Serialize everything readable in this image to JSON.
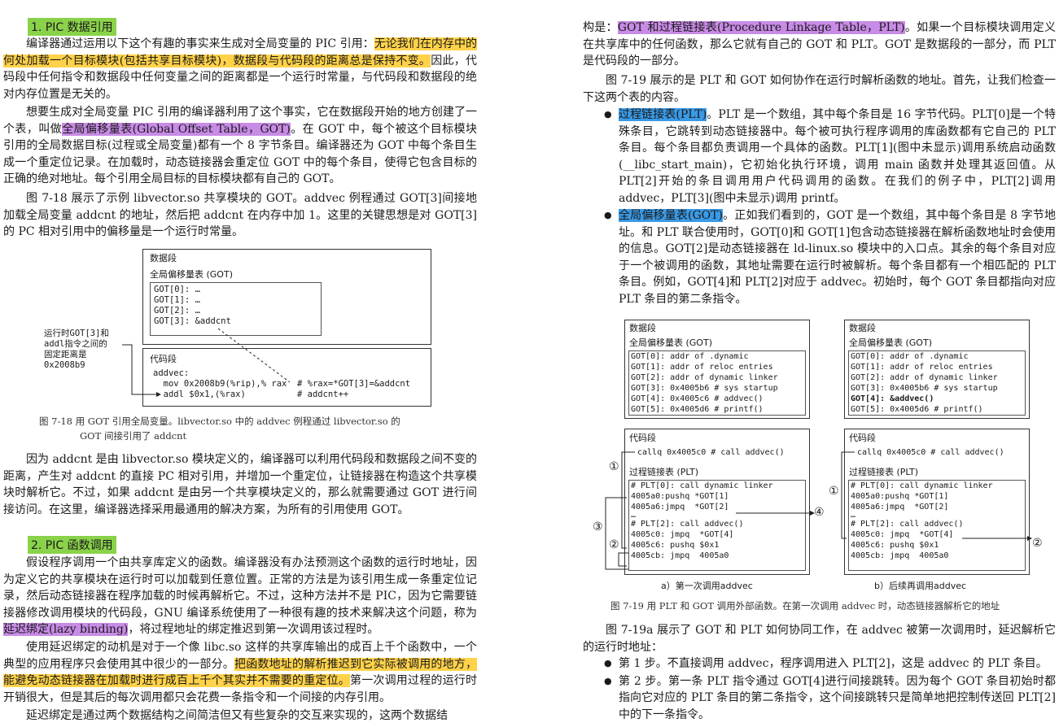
{
  "left": {
    "heading1": "1. PIC 数据引用",
    "p1_a": "编译器通过运用以下这个有趣的事实来生成对全局变量的 PIC 引用：",
    "p1_hl": "无论我们在内存中的何处加载一个目标模块(包括共享目标模块)，数据段与代码段的距离总是保持不变。",
    "p1_b": "因此，代码段中任何指令和数据段中任何变量之间的距离都是一个运行时常量，与代码段和数据段的绝对内存位置是无关的。",
    "p2_a": "想要生成对全局变量 PIC 引用的编译器利用了这个事实，它在数据段开始的地方创建了一个表，叫做",
    "p2_hl": "全局偏移量表(Global Offset Table，GOT)",
    "p2_b": "。在 GOT 中，每个被这个目标模块引用的全局数据目标(过程或全局变量)都有一个 8 字节条目。编译器还为 GOT 中每个条目生成一个重定位记录。在加载时，动态链接器会重定位 GOT 中的每个条目，使得它包含目标的正确的绝对地址。每个引用全局目标的目标模块都有自己的 GOT。",
    "p3": "图 7-18 展示了示例 libvector.so 共享模块的 GOT。addvec 例程通过 GOT[3]间接地加载全局变量 addcnt 的地址，然后把 addcnt 在内存中加 1。这里的关键思想是对 GOT[3]的 PC 相对引用中的偏移量是一个运行时常量。",
    "fig718": {
      "data_seg": "数据段",
      "got_title": "全局偏移量表 (GOT)",
      "got_rows": [
        "GOT[0]: …",
        "GOT[1]: …",
        "GOT[2]: …",
        "GOT[3]: &addcnt"
      ],
      "code_seg": "代码段",
      "code_lines": [
        "addvec:",
        "  mov 0x2008b9(%rip),% rax  # %rax=*GOT[3]=&addcnt",
        "  addl $0x1,(%rax)          # addcnt++"
      ],
      "side_note": "运行时GOT[3]和\naddl指令之间的\n固定距离是\n0x2008b9",
      "caption_1": "图 7-18  用 GOT 引用全局变量。libvector.so 中的 addvec 例程通过 libvector.so 的",
      "caption_2": "GOT 间接引用了 addcnt"
    },
    "p4": "因为 addcnt 是由 libvector.so 模块定义的，编译器可以利用代码段和数据段之间不变的距离，产生对 addcnt 的直接 PC 相对引用，并增加一个重定位，让链接器在构造这个共享模块时解析它。不过，如果 addcnt 是由另一个共享模块定义的，那么就需要通过 GOT 进行间接访问。在这里，编译器选择采用最通用的解决方案，为所有的引用使用 GOT。",
    "heading2": "2. PIC 函数调用",
    "p5_a": "假设程序调用一个由共享库定义的函数。编译器没有办法预测这个函数的运行时地址，因为定义它的共享模块在运行时可以加载到任意位置。正常的方法是为该引用生成一条重定位记录，然后动态链接器在程序加载的时候再解析它。不过，这种方法并不是 PIC，因为它需要链接器修改调用模块的代码段，GNU 编译系统使用了一种很有趣的技术来解决这个问题，称为",
    "p5_hl": "延迟绑定(lazy binding)",
    "p5_b": "，将过程地址的绑定推迟到第一次调用该过程时。",
    "p6_a": "使用延迟绑定的动机是对于一个像 libc.so 这样的共享库输出的成百上千个函数中，一个典型的应用程序只会使用其中很少的一部分。",
    "p6_hl": "把函数地址的解析推迟到它实际被调用的地方，能避免动态链接器在加载时进行成百上千个其实并不需要的重定位。",
    "p6_b": "第一次调用过程的运行时开销很大，但是其后的每次调用都只会花费一条指令和一个间接的内存引用。",
    "p7": "延迟绑定是通过两个数据结构之间简洁但又有些复杂的交互来实现的，这两个数据结"
  },
  "right": {
    "r1_a": "构是：",
    "r1_hl": "GOT 和过程链接表(Procedure Linkage Table，PLT)",
    "r1_b": "。如果一个目标模块调用定义在共享库中的任何函数，那么它就有自己的 GOT 和 PLT。GOT 是数据段的一部分，而 PLT 是代码段的一部分。",
    "r2": "图 7-19 展示的是 PLT 和 GOT 如何协作在运行时解析函数的地址。首先，让我们检查一下这两个表的内容。",
    "b1_hl": "过程链接表(PLT)",
    "b1": "。PLT 是一个数组，其中每个条目是 16 字节代码。PLT[0]是一个特殊条目，它跳转到动态链接器中。每个被可执行程序调用的库函数都有它自己的 PLT 条目。每个条目都负责调用一个具体的函数。PLT[1](图中未显示)调用系统启动函数(__libc_start_main)，它初始化执行环境，调用 main 函数并处理其返回值。从 PLT[2]开始的条目调用用户代码调用的函数。在我们的例子中，PLT[2]调用 addvec，PLT[3](图中未显示)调用 printf。",
    "b2_hl": "全局偏移量表(GOT)",
    "b2": "。正如我们看到的，GOT 是一个数组，其中每个条目是 8 字节地址。和 PLT 联合使用时，GOT[0]和 GOT[1]包含动态链接器在解析函数地址时会使用的信息。GOT[2]是动态链接器在 ld-linux.so 模块中的入口点。其余的每个条目对应于一个被调用的函数，其地址需要在运行时被解析。每个条目都有一个相匹配的 PLT 条目。例如，GOT[4]和 PLT[2]对应于 addvec。初始时，每个 GOT 条目都指向对应 PLT 条目的第二条指令。",
    "fig719": {
      "data_seg": "数据段",
      "got_title": "全局偏移量表 (GOT)",
      "got_a": [
        "GOT[0]: addr of .dynamic",
        "GOT[1]: addr of reloc entries",
        "GOT[2]: addr of dynamic linker",
        "GOT[3]: 0x4005b6 # sys startup",
        "GOT[4]: 0x4005c6 # addvec()",
        "GOT[5]: 0x4005d6 # printf()"
      ],
      "got_b": [
        "GOT[0]: addr of .dynamic",
        "GOT[1]: addr of reloc entries",
        "GOT[2]: addr of dynamic linker",
        "GOT[3]: 0x4005b6 # sys startup",
        "GOT[4]: &addvec()",
        "GOT[5]: 0x4005d6 # printf()"
      ],
      "code_seg": "代码段",
      "callq": "callq 0x4005c0 # call addvec()",
      "plt_title": "过程链接表 (PLT)",
      "plt0": [
        "# PLT[0]: call dynamic linker",
        "4005a0:pushq *GOT[1]",
        "4005a6:jmpq  *GOT[2]",
        "…"
      ],
      "plt2": [
        "# PLT[2]: call addvec()",
        "4005c0: jmpq  *GOT[4]",
        "4005c6: pushq $0x1",
        "4005cb: jmpq  4005a0"
      ],
      "n1": "①",
      "n2": "②",
      "n3": "③",
      "n4": "④",
      "sub_a": "a）第一次调用addvec",
      "sub_b": "b）后续再调用addvec",
      "caption": "图 7-19  用 PLT 和 GOT 调用外部函数。在第一次调用 addvec 时，动态链接器解析它的地址"
    },
    "r3": "图 7-19a 展示了 GOT 和 PLT 如何协同工作，在 addvec 被第一次调用时，延迟解析它的运行时地址：",
    "s1": "第 1 步。不直接调用 addvec，程序调用进入 PLT[2]，这是 addvec 的 PLT 条目。",
    "s2": "第 2 步。第一条 PLT 指令通过 GOT[4]进行间接跳转。因为每个 GOT 条目初始时都指向它对应的 PLT 条目的第二条指令，这个间接跳转只是简单地把控制传送回 PLT[2]中的下一条指令。"
  }
}
